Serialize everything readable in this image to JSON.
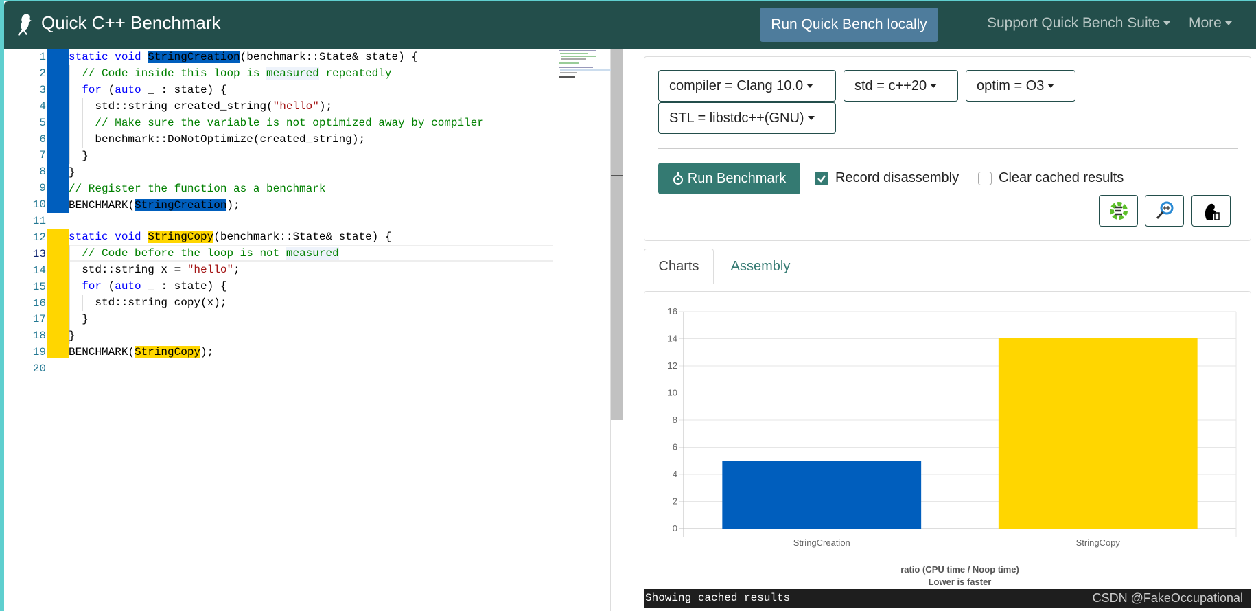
{
  "nav": {
    "title": "Quick C++ Benchmark",
    "run_locally": "Run Quick Bench locally",
    "support": "Support Quick Bench Suite",
    "more": "More"
  },
  "editor": {
    "lines": [
      {
        "n": "1"
      },
      {
        "n": "2"
      },
      {
        "n": "3"
      },
      {
        "n": "4"
      },
      {
        "n": "5"
      },
      {
        "n": "6"
      },
      {
        "n": "7"
      },
      {
        "n": "8"
      },
      {
        "n": "9"
      },
      {
        "n": "10"
      },
      {
        "n": "11"
      },
      {
        "n": "12"
      },
      {
        "n": "13"
      },
      {
        "n": "14"
      },
      {
        "n": "15"
      },
      {
        "n": "16"
      },
      {
        "n": "17"
      },
      {
        "n": "18"
      },
      {
        "n": "19"
      },
      {
        "n": "20"
      }
    ],
    "tokens": {
      "static_void": "static void ",
      "for": "for",
      "auto": "auto",
      "lp": " (",
      "rest_for": " _ : state) {",
      "StringCreation": "StringCreation",
      "StringCopy": "StringCopy",
      "sig_rest": "(benchmark::State& state) {",
      "c2a": "// Code inside this loop is ",
      "measured": "measured",
      "c2b": " repeatedly",
      "l4a": "std::string created_string(",
      "hello": "\"hello\"",
      "l4b": ");",
      "c5": "// Make sure the variable is not optimized away by compiler",
      "l6": "benchmark::DoNotOptimize(created_string);",
      "close": "}",
      "c9": "// Register the function as a benchmark",
      "bm_open": "BENCHMARK(",
      "bm_close": ");",
      "c13": "// Code before the loop is not ",
      "l14a": "std::string x = ",
      "l14b": ";",
      "l16": "std::string copy(x);"
    }
  },
  "controls": {
    "compiler": "compiler = Clang 10.0",
    "std": "std = c++20",
    "optim": "optim = O3",
    "stl": "STL = libstdc++(GNU)",
    "run_benchmark": "Run Benchmark",
    "record_disassembly": "Record disassembly",
    "record_checked": true,
    "clear_cached": "Clear cached results",
    "clear_checked": false,
    "icon_buttons": [
      "cppinsights-icon",
      "quickbench-zoom-icon",
      "build-bench-icon"
    ]
  },
  "tabs": [
    {
      "label": "Charts",
      "active": true
    },
    {
      "label": "Assembly",
      "active": false
    }
  ],
  "chart_data": {
    "type": "bar",
    "categories": [
      "StringCreation",
      "StringCopy"
    ],
    "values": [
      4.97,
      14.03
    ],
    "colors": [
      "#005ebd",
      "#ffd600"
    ],
    "ylim": [
      0,
      16
    ],
    "yticks": [
      "0",
      "2",
      "4",
      "6",
      "8",
      "10",
      "12",
      "14",
      "16"
    ],
    "xlabel": "ratio (CPU time / Noop time)",
    "xlabel2": "Lower is faster",
    "grid": true
  },
  "status": "Showing cached results",
  "watermark": "CSDN @FakeOccupational",
  "colors": {
    "navbar": "#234e4b",
    "accent": "#347a72",
    "run_locally": "#4e7c9c"
  }
}
